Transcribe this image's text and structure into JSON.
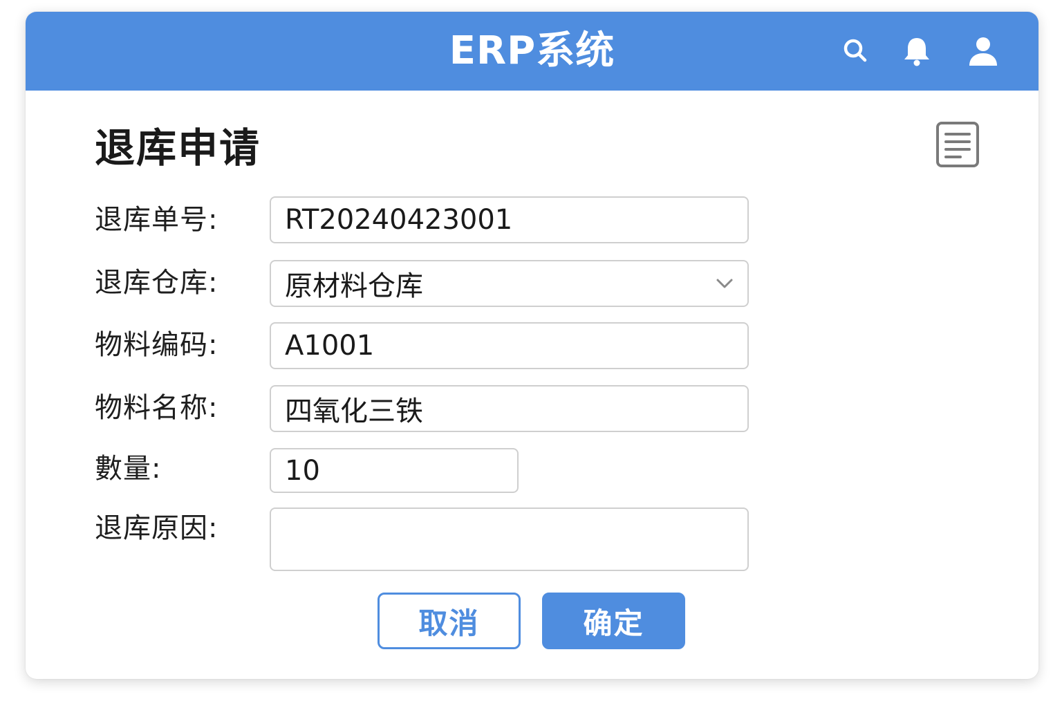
{
  "colors": {
    "accent": "#4f8ddf",
    "header_bg": "#4f8ddf",
    "border": "#cfcfcf",
    "icon_gray": "#7a7a7a"
  },
  "header": {
    "app_title": "ERP系统",
    "icons": [
      "search-icon",
      "bell-icon",
      "user-icon"
    ]
  },
  "page": {
    "title": "退库申请",
    "doc_icon": "document-icon"
  },
  "form": {
    "return_no": {
      "label": "退库单号:",
      "value": "RT20240423001"
    },
    "warehouse": {
      "label": "退库仓库:",
      "value": "原材料仓库",
      "icon": "chevron-down-icon"
    },
    "material_code": {
      "label": "物料编码:",
      "value": "A1001"
    },
    "material_name": {
      "label": "物料名称:",
      "value": "四氧化三铁"
    },
    "quantity": {
      "label": "數量:",
      "value": "10"
    },
    "reason": {
      "label": "退库原因:",
      "value": ""
    }
  },
  "buttons": {
    "cancel": "取消",
    "confirm": "确定"
  }
}
